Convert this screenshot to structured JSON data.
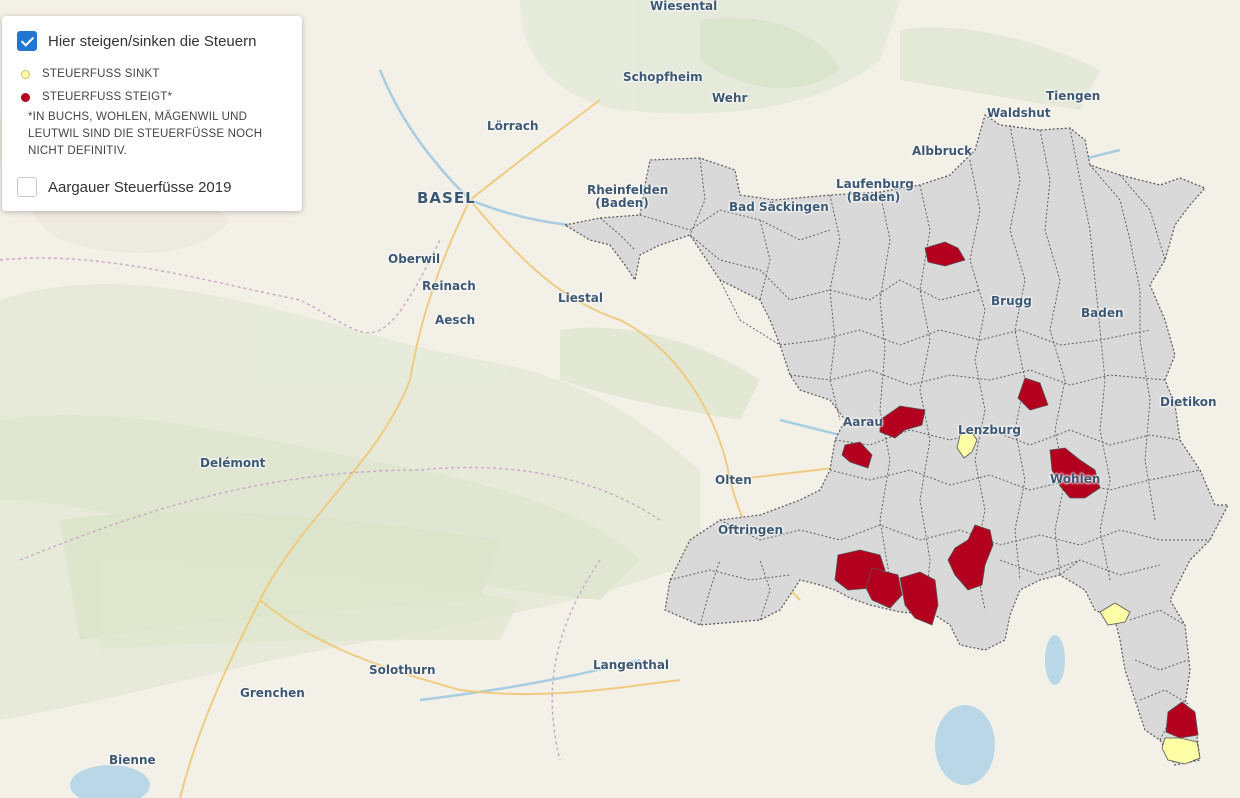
{
  "colors": {
    "region_fill": "#d9d9d9",
    "region_border": "#555555",
    "rising": "#b3001e",
    "falling": "#ffffa6",
    "checkbox": "#1f77d1"
  },
  "layers": [
    {
      "label": "Hier steigen/sinken die Steuern",
      "checked": true
    },
    {
      "label": "Aargauer Steuerfüsse 2019",
      "checked": false
    }
  ],
  "legend": {
    "items": [
      {
        "label": "STEUERFUSS SINKT",
        "color": "#ffffa6"
      },
      {
        "label": "STEUERFUSS STEIGT*",
        "color": "#b3001e"
      }
    ],
    "note": "*IN BUCHS, WOHLEN, MÄGENWIL UND LEUTWIL SIND DIE STEUERFÜSSE NOCH NICHT DEFINITIV."
  },
  "places": {
    "wiesental": "Wiesental",
    "schopfheim": "Schopfheim",
    "wehr": "Wehr",
    "waldshut": "Waldshut",
    "tiengen": "Tiengen",
    "loerrach": "Lörrach",
    "albbruck": "Albbruck",
    "rheinfelden_1": "Rheinfelden",
    "rheinfelden_2": "(Baden)",
    "laufenburg_1": "Laufenburg",
    "laufenburg_2": "(Baden)",
    "basel": "BASEL",
    "bad_saeckingen": "Bad Säckingen",
    "oberwil": "Oberwil",
    "reinach": "Reinach",
    "liestal": "Liestal",
    "aesch": "Aesch",
    "brugg": "Brugg",
    "baden": "Baden",
    "aarau": "Aarau",
    "lenzburg": "Lenzburg",
    "dietikon": "Dietikon",
    "delemont": "Delémont",
    "olten": "Olten",
    "wohlen": "Wohlen",
    "oftringen": "Oftringen",
    "langenthal": "Langenthal",
    "solothurn": "Solothurn",
    "grenchen": "Grenchen",
    "biel": "Bienne"
  }
}
